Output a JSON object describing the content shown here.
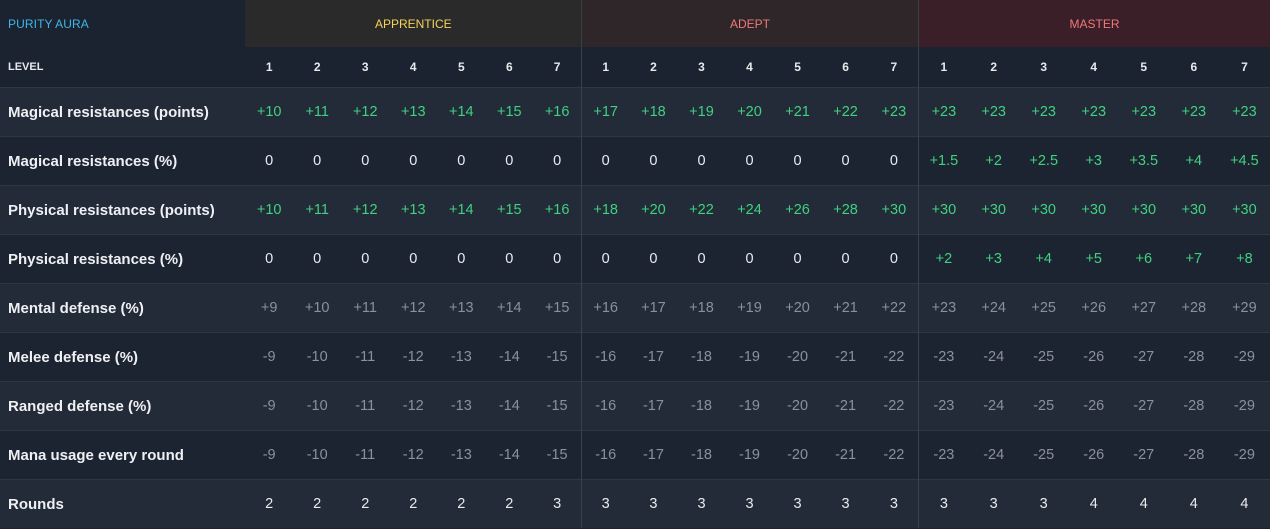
{
  "table": {
    "corner_label": "PURITY AURA",
    "level_label": "LEVEL",
    "tiers": [
      {
        "name": "APPRENTICE",
        "color": "#f3d35a"
      },
      {
        "name": "ADEPT",
        "color": "#f07878"
      },
      {
        "name": "MASTER",
        "color": "#f07878"
      }
    ],
    "levels": [
      "1",
      "2",
      "3",
      "4",
      "5",
      "6",
      "7",
      "1",
      "2",
      "3",
      "4",
      "5",
      "6",
      "7",
      "1",
      "2",
      "3",
      "4",
      "5",
      "6",
      "7"
    ],
    "rows": [
      {
        "label": "Magical resistances (points)",
        "style": "green",
        "values": [
          "+10",
          "+11",
          "+12",
          "+13",
          "+14",
          "+15",
          "+16",
          "+17",
          "+18",
          "+19",
          "+20",
          "+21",
          "+22",
          "+23",
          "+23",
          "+23",
          "+23",
          "+23",
          "+23",
          "+23",
          "+23"
        ]
      },
      {
        "label": "Magical resistances (%)",
        "style": "mixed",
        "values": [
          "0",
          "0",
          "0",
          "0",
          "0",
          "0",
          "0",
          "0",
          "0",
          "0",
          "0",
          "0",
          "0",
          "0",
          "+1.5",
          "+2",
          "+2.5",
          "+3",
          "+3.5",
          "+4",
          "+4.5"
        ]
      },
      {
        "label": "Physical resistances (points)",
        "style": "green",
        "values": [
          "+10",
          "+11",
          "+12",
          "+13",
          "+14",
          "+15",
          "+16",
          "+18",
          "+20",
          "+22",
          "+24",
          "+26",
          "+28",
          "+30",
          "+30",
          "+30",
          "+30",
          "+30",
          "+30",
          "+30",
          "+30"
        ]
      },
      {
        "label": "Physical resistances (%)",
        "style": "mixed",
        "values": [
          "0",
          "0",
          "0",
          "0",
          "0",
          "0",
          "0",
          "0",
          "0",
          "0",
          "0",
          "0",
          "0",
          "0",
          "+2",
          "+3",
          "+4",
          "+5",
          "+6",
          "+7",
          "+8"
        ]
      },
      {
        "label": "Mental defense (%)",
        "style": "gray",
        "values": [
          "+9",
          "+10",
          "+11",
          "+12",
          "+13",
          "+14",
          "+15",
          "+16",
          "+17",
          "+18",
          "+19",
          "+20",
          "+21",
          "+22",
          "+23",
          "+24",
          "+25",
          "+26",
          "+27",
          "+28",
          "+29"
        ]
      },
      {
        "label": "Melee defense (%)",
        "style": "gray",
        "values": [
          "-9",
          "-10",
          "-11",
          "-12",
          "-13",
          "-14",
          "-15",
          "-16",
          "-17",
          "-18",
          "-19",
          "-20",
          "-21",
          "-22",
          "-23",
          "-24",
          "-25",
          "-26",
          "-27",
          "-28",
          "-29"
        ]
      },
      {
        "label": "Ranged defense (%)",
        "style": "gray",
        "values": [
          "-9",
          "-10",
          "-11",
          "-12",
          "-13",
          "-14",
          "-15",
          "-16",
          "-17",
          "-18",
          "-19",
          "-20",
          "-21",
          "-22",
          "-23",
          "-24",
          "-25",
          "-26",
          "-27",
          "-28",
          "-29"
        ]
      },
      {
        "label": "Mana usage every round",
        "style": "gray",
        "values": [
          "-9",
          "-10",
          "-11",
          "-12",
          "-13",
          "-14",
          "-15",
          "-16",
          "-17",
          "-18",
          "-19",
          "-20",
          "-21",
          "-22",
          "-23",
          "-24",
          "-25",
          "-26",
          "-27",
          "-28",
          "-29"
        ]
      },
      {
        "label": "Rounds",
        "style": "white",
        "values": [
          "2",
          "2",
          "2",
          "2",
          "2",
          "2",
          "3",
          "3",
          "3",
          "3",
          "3",
          "3",
          "3",
          "3",
          "3",
          "3",
          "3",
          "4",
          "4",
          "4",
          "4"
        ]
      }
    ]
  }
}
